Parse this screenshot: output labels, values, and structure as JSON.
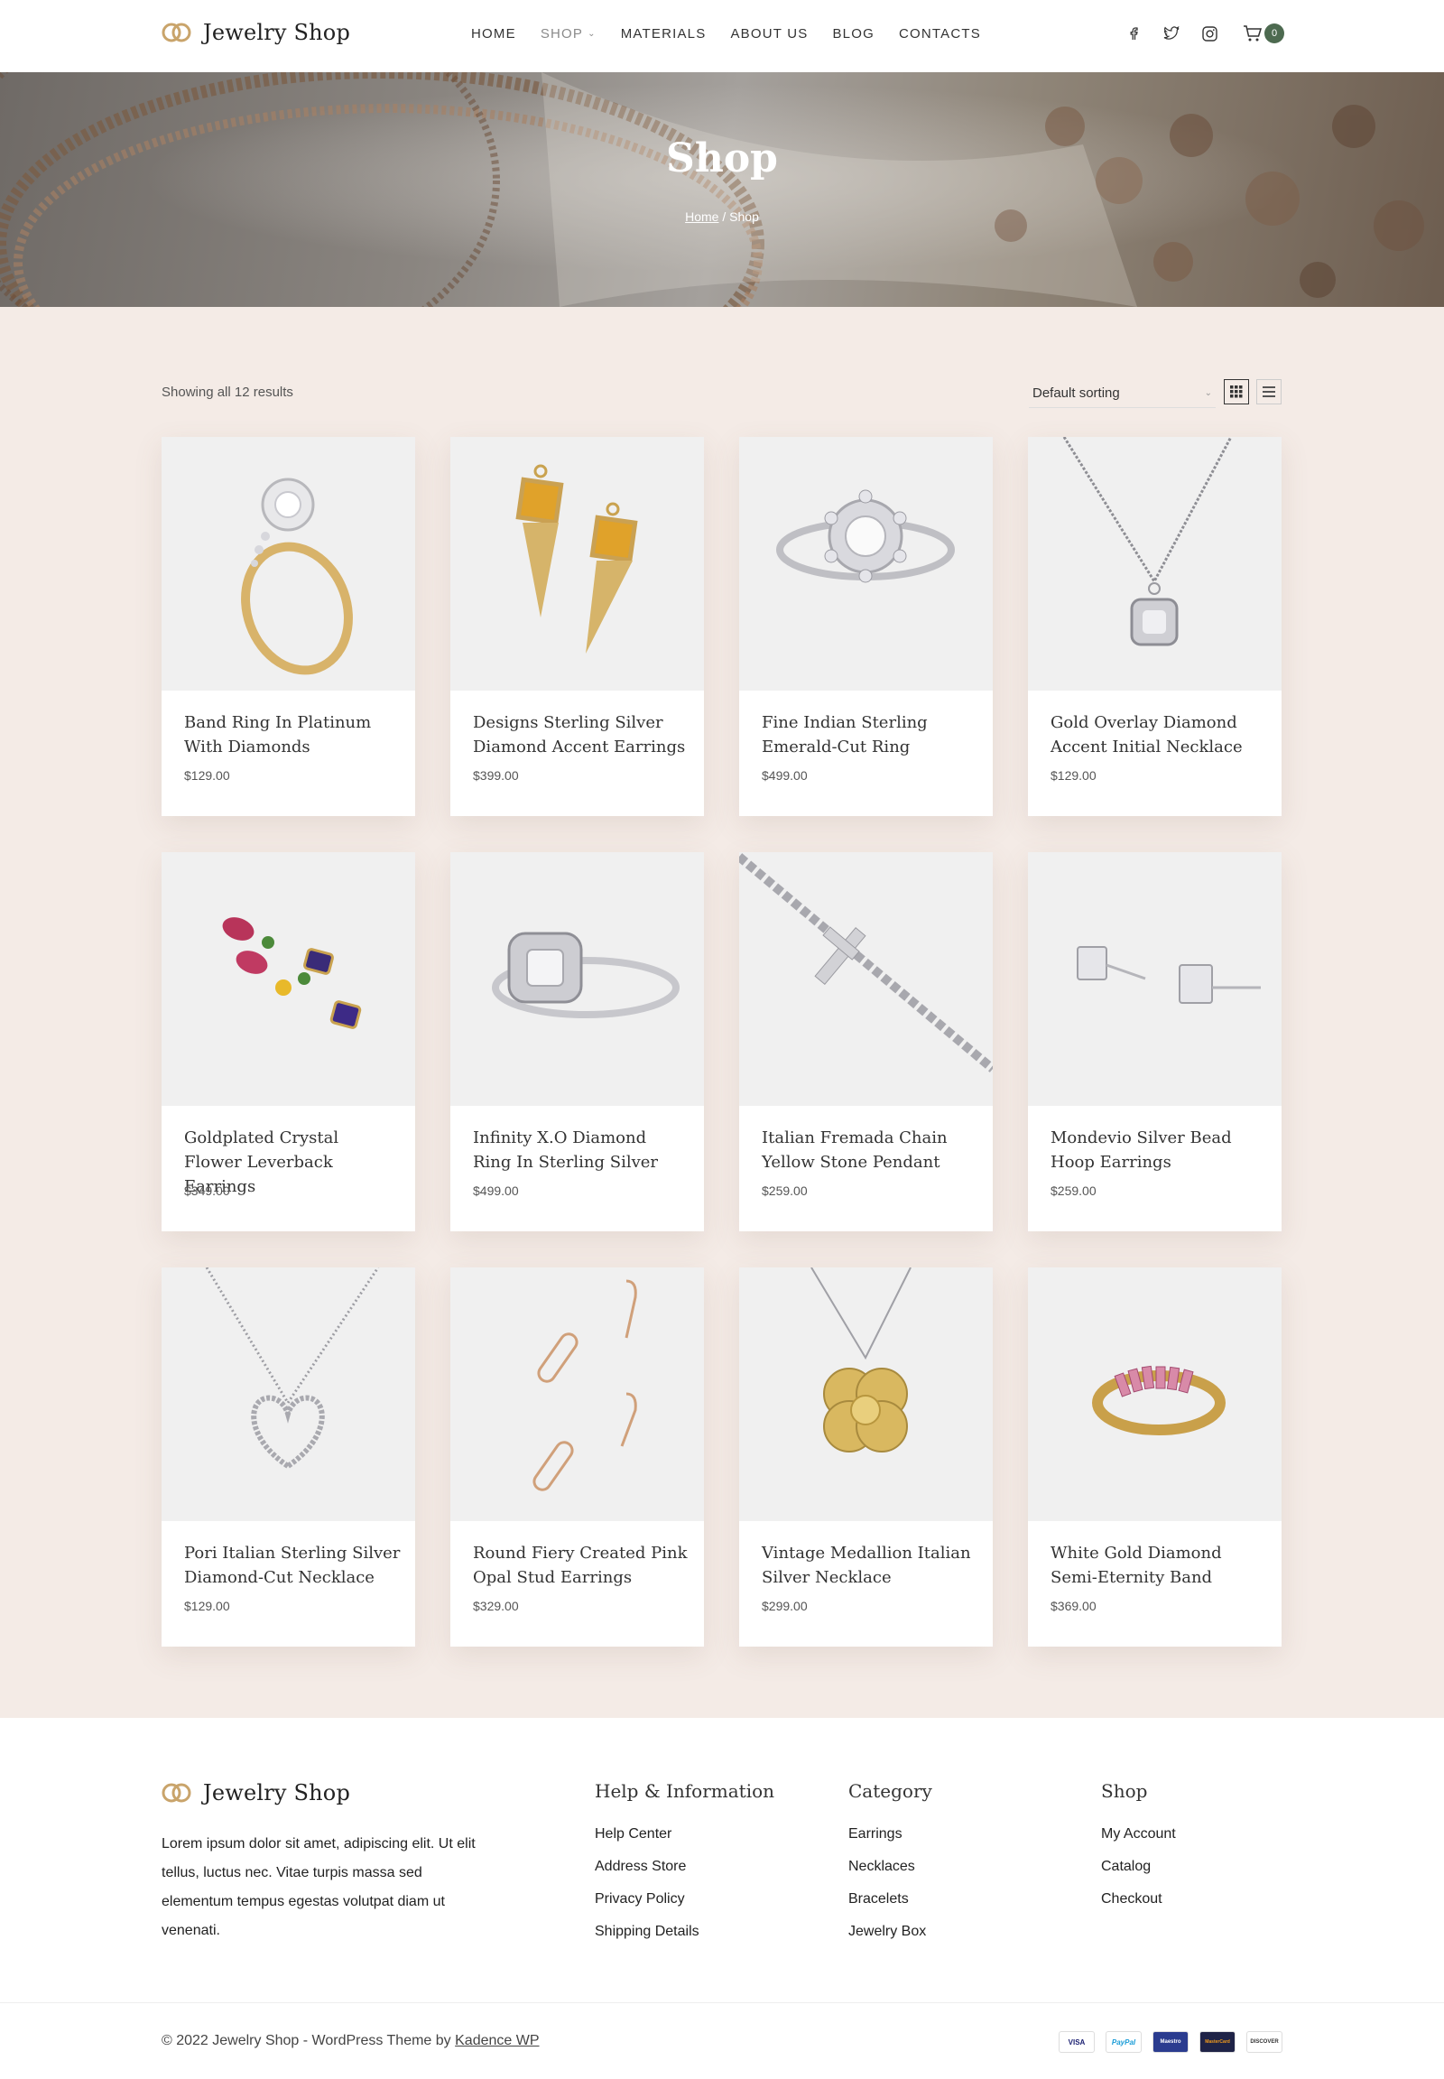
{
  "brand": {
    "name": "Jewelry Shop",
    "accent": "#c9a46b",
    "badge_color": "#4d6a50"
  },
  "nav": [
    {
      "label": "HOME",
      "active": false,
      "dropdown": false
    },
    {
      "label": "SHOP",
      "active": true,
      "dropdown": true
    },
    {
      "label": "MATERIALS",
      "active": false,
      "dropdown": false
    },
    {
      "label": "ABOUT US",
      "active": false,
      "dropdown": false
    },
    {
      "label": "BLOG",
      "active": false,
      "dropdown": false
    },
    {
      "label": "CONTACTS",
      "active": false,
      "dropdown": false
    }
  ],
  "social_icons": [
    "facebook-icon",
    "twitter-icon",
    "instagram-icon"
  ],
  "cart": {
    "count": "0"
  },
  "hero": {
    "title": "Shop",
    "breadcrumb_home": "Home",
    "breadcrumb_separator": " / ",
    "breadcrumb_current": "Shop"
  },
  "shop": {
    "results_text": "Showing all 12 results",
    "sort_label": "Default sorting",
    "background": "#f4ebe6"
  },
  "products": [
    {
      "title": "Band Ring In Platinum With Diamonds",
      "price": "$129.00",
      "image": "gold-diamond-ring"
    },
    {
      "title": "Designs Sterling Silver Diamond Accent Earrings",
      "price": "$399.00",
      "image": "citrine-spike-earrings"
    },
    {
      "title": "Fine Indian Sterling Emerald-Cut Ring",
      "price": "$499.00",
      "image": "silver-flower-ring"
    },
    {
      "title": "Gold Overlay Diamond Accent Initial Necklace",
      "price": "$129.00",
      "image": "cushion-pendant-necklace"
    },
    {
      "title": "Goldplated Crystal Flower Leverback Earrings",
      "price": "$349.00",
      "image": "multicolor-gem-earrings"
    },
    {
      "title": "Infinity X.O Diamond Ring In Sterling Silver",
      "price": "$499.00",
      "image": "cushion-halo-ring"
    },
    {
      "title": "Italian Fremada Chain Yellow Stone Pendant",
      "price": "$259.00",
      "image": "cross-chain-bracelet"
    },
    {
      "title": "Mondevio Silver Bead Hoop Earrings",
      "price": "$259.00",
      "image": "baguette-stud-earrings"
    },
    {
      "title": "Pori Italian Sterling Silver Diamond-Cut Necklace",
      "price": "$129.00",
      "image": "heart-pendant-necklace"
    },
    {
      "title": "Round Fiery Created Pink Opal Stud Earrings",
      "price": "$329.00",
      "image": "rose-gold-drop-earrings"
    },
    {
      "title": "Vintage Medallion Italian Silver Necklace",
      "price": "$299.00",
      "image": "flower-medallion-necklace"
    },
    {
      "title": "White Gold Diamond Semi-Eternity Band",
      "price": "$369.00",
      "image": "pink-sapphire-band"
    }
  ],
  "footer": {
    "about": "Lorem ipsum dolor sit amet, adipiscing elit. Ut elit tellus, luctus nec. Vitae turpis massa sed elementum tempus egestas volutpat diam ut venenati.",
    "columns": [
      {
        "heading": "Help & Information",
        "links": [
          "Help Center",
          "Address Store",
          "Privacy Policy",
          "Shipping Details"
        ]
      },
      {
        "heading": "Category",
        "links": [
          "Earrings",
          "Necklaces",
          "Bracelets",
          "Jewelry Box"
        ]
      },
      {
        "heading": "Shop",
        "links": [
          "My Account",
          "Catalog",
          "Checkout"
        ]
      }
    ],
    "copyright_prefix": "© 2022 Jewelry Shop - WordPress Theme by ",
    "copyright_link": "Kadence WP",
    "payments": [
      "VISA",
      "PayPal",
      "Maestro",
      "MasterCard",
      "DISCOVER"
    ]
  }
}
